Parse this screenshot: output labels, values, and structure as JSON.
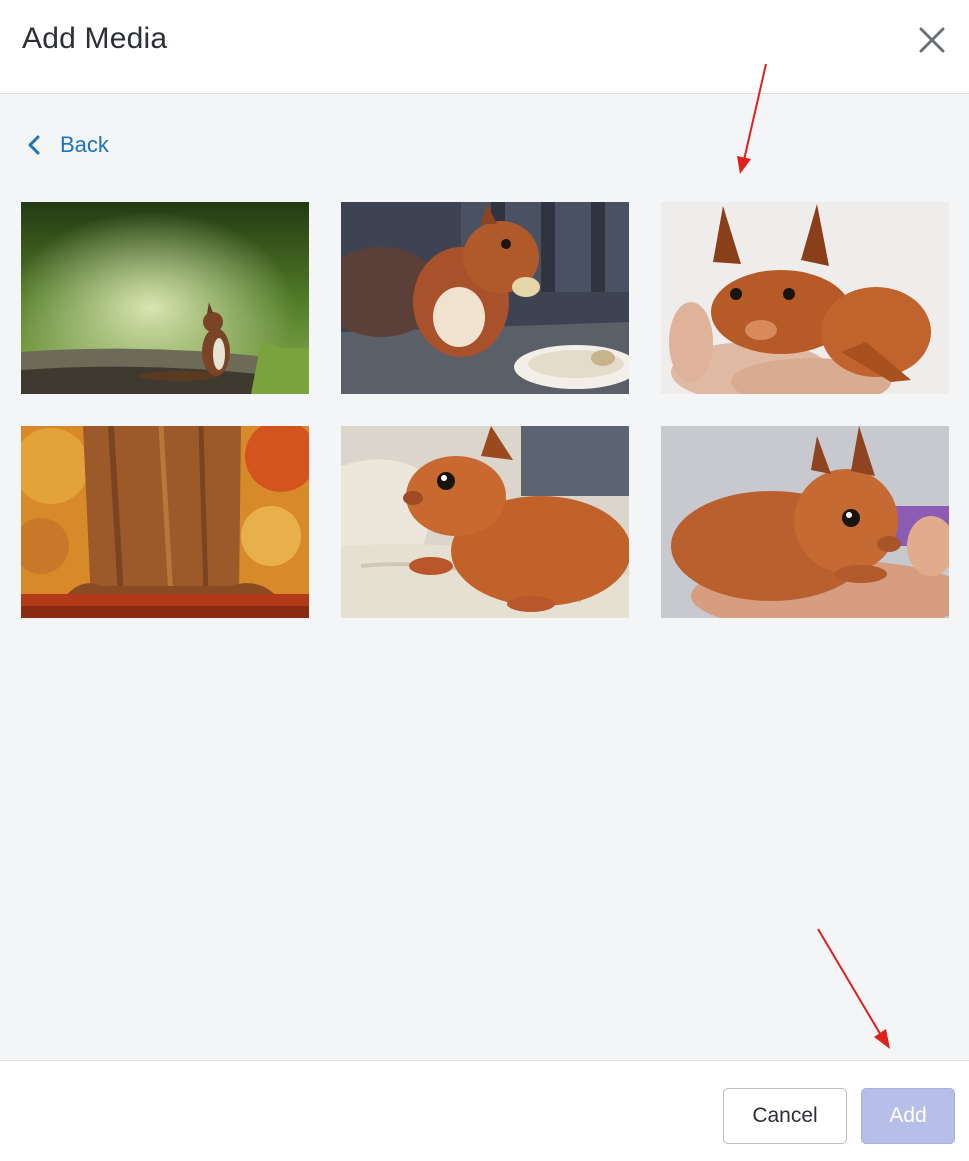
{
  "dialog": {
    "title": "Add Media",
    "close_icon": "close-icon"
  },
  "nav": {
    "back_label": "Back",
    "back_icon": "chevron-left-icon"
  },
  "media": [
    {
      "subject": "squirrel on forest path"
    },
    {
      "subject": "squirrel eating a peanut"
    },
    {
      "subject": "young squirrel held in hand"
    },
    {
      "subject": "autumn tree trunk"
    },
    {
      "subject": "young squirrel on blanket"
    },
    {
      "subject": "young squirrel resting on hand"
    }
  ],
  "footer": {
    "cancel_label": "Cancel",
    "add_label": "Add"
  },
  "colors": {
    "accent_link": "#1f73b7",
    "add_button_disabled": "#b7bfe8",
    "annotation_arrow": "#e0201b"
  }
}
